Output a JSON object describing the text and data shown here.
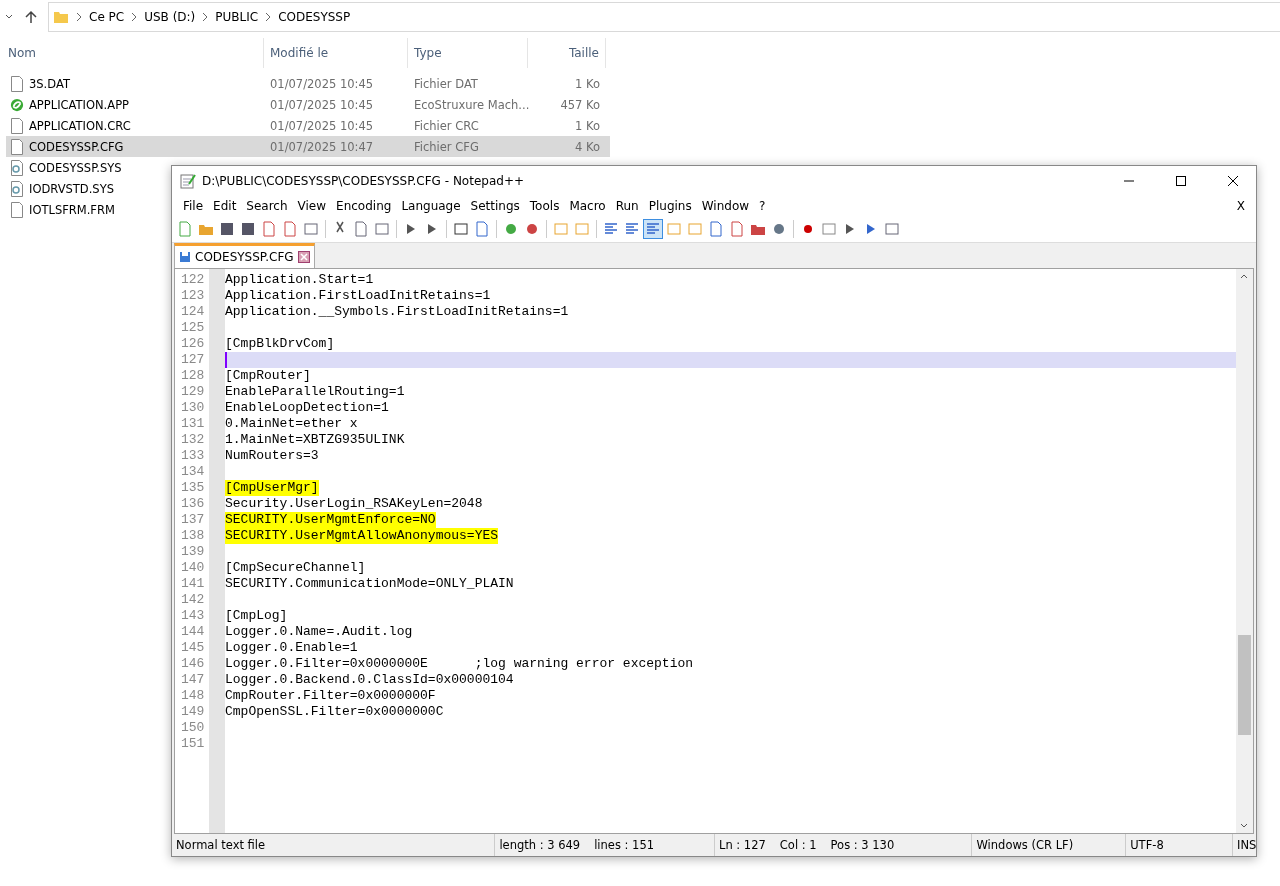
{
  "explorer": {
    "breadcrumb": [
      "Ce PC",
      "USB (D:)",
      "PUBLIC",
      "CODESYSSP"
    ],
    "columns": [
      "Nom",
      "Modifié le",
      "Type",
      "Taille"
    ],
    "rows": [
      {
        "kind": "file",
        "name": "3S.DAT",
        "modified": "01/07/2025 10:45",
        "type": "Fichier DAT",
        "size": "1 Ko",
        "selected": false
      },
      {
        "kind": "app",
        "name": "APPLICATION.APP",
        "modified": "01/07/2025 10:45",
        "type": "EcoStruxure Mach...",
        "size": "457 Ko",
        "selected": false
      },
      {
        "kind": "file",
        "name": "APPLICATION.CRC",
        "modified": "01/07/2025 10:45",
        "type": "Fichier CRC",
        "size": "1 Ko",
        "selected": false
      },
      {
        "kind": "file",
        "name": "CODESYSSP.CFG",
        "modified": "01/07/2025 10:47",
        "type": "Fichier CFG",
        "size": "4 Ko",
        "selected": true
      },
      {
        "kind": "system",
        "name": "CODESYSSP.SYS",
        "selected": false
      },
      {
        "kind": "system",
        "name": "IODRVSTD.SYS",
        "selected": false
      },
      {
        "kind": "file",
        "name": "IOTLSFRM.FRM",
        "selected": false
      }
    ]
  },
  "notepad": {
    "title": "D:\\PUBLIC\\CODESYSSP\\CODESYSSP.CFG - Notepad++",
    "menu": [
      "File",
      "Edit",
      "Search",
      "View",
      "Encoding",
      "Language",
      "Settings",
      "Tools",
      "Macro",
      "Run",
      "Plugins",
      "Window",
      "?"
    ],
    "menu_close": "X",
    "tabs": [
      {
        "label": "CODESYSSP.CFG",
        "selected": true
      }
    ],
    "lines": [
      {
        "number": "122",
        "text": "Application.Start=1",
        "highlighted": false,
        "current": false
      },
      {
        "number": "123",
        "text": "Application.FirstLoadInitRetains=1",
        "highlighted": false,
        "current": false
      },
      {
        "number": "124",
        "text": "Application.__Symbols.FirstLoadInitRetains=1",
        "highlighted": false,
        "current": false
      },
      {
        "number": "125",
        "current": false
      },
      {
        "number": "126",
        "text": "[CmpBlkDrvCom]",
        "highlighted": false,
        "current": false
      },
      {
        "number": "127",
        "current": true
      },
      {
        "number": "128",
        "text": "[CmpRouter]",
        "highlighted": false,
        "current": false
      },
      {
        "number": "129",
        "text": "EnableParallelRouting=1",
        "highlighted": false,
        "current": false
      },
      {
        "number": "130",
        "text": "EnableLoopDetection=1",
        "highlighted": false,
        "current": false
      },
      {
        "number": "131",
        "text": "0.MainNet=ether x",
        "highlighted": false,
        "current": false
      },
      {
        "number": "132",
        "text": "1.MainNet=XBTZG935ULINK",
        "highlighted": false,
        "current": false
      },
      {
        "number": "133",
        "text": "NumRouters=3",
        "highlighted": false,
        "current": false
      },
      {
        "number": "134",
        "current": false
      },
      {
        "number": "135",
        "text": "[CmpUserMgr]",
        "highlighted": true,
        "current": false
      },
      {
        "number": "136",
        "text": "Security.UserLogin_RSAKeyLen=2048",
        "highlighted": false,
        "current": false
      },
      {
        "number": "137",
        "text": "SECURITY.UserMgmtEnforce=NO",
        "highlighted": true,
        "current": false
      },
      {
        "number": "138",
        "text": "SECURITY.UserMgmtAllowAnonymous=YES",
        "highlighted": true,
        "current": false
      },
      {
        "number": "139",
        "current": false
      },
      {
        "number": "140",
        "text": "[CmpSecureChannel]",
        "highlighted": false,
        "current": false
      },
      {
        "number": "141",
        "text": "SECURITY.CommunicationMode=ONLY_PLAIN",
        "highlighted": false,
        "current": false
      },
      {
        "number": "142",
        "current": false
      },
      {
        "number": "143",
        "text": "[CmpLog]",
        "highlighted": false,
        "current": false
      },
      {
        "number": "144",
        "text": "Logger.0.Name=.Audit.log",
        "highlighted": false,
        "current": false
      },
      {
        "number": "145",
        "text": "Logger.0.Enable=1",
        "highlighted": false,
        "current": false
      },
      {
        "number": "146",
        "text": "Logger.0.Filter=0x0000000E      ;log warning error exception",
        "highlighted": false,
        "current": false
      },
      {
        "number": "147",
        "text": "Logger.0.Backend.0.ClassId=0x00000104",
        "highlighted": false,
        "current": false
      },
      {
        "number": "148",
        "text": "CmpRouter.Filter=0x0000000F",
        "highlighted": false,
        "current": false
      },
      {
        "number": "149",
        "text": "CmpOpenSSL.Filter=0x0000000C",
        "highlighted": false,
        "current": false
      },
      {
        "number": "150",
        "current": false
      },
      {
        "number": "151",
        "current": false
      }
    ],
    "status_bar": {
      "file_type": "Normal text file",
      "length": "length : 3 649",
      "lines": "lines : 151",
      "ln": "Ln : 127",
      "col": "Col : 1",
      "pos": "Pos : 3 130",
      "eol": "Windows (CR LF)",
      "encoding": "UTF-8",
      "mode": "INS"
    }
  }
}
